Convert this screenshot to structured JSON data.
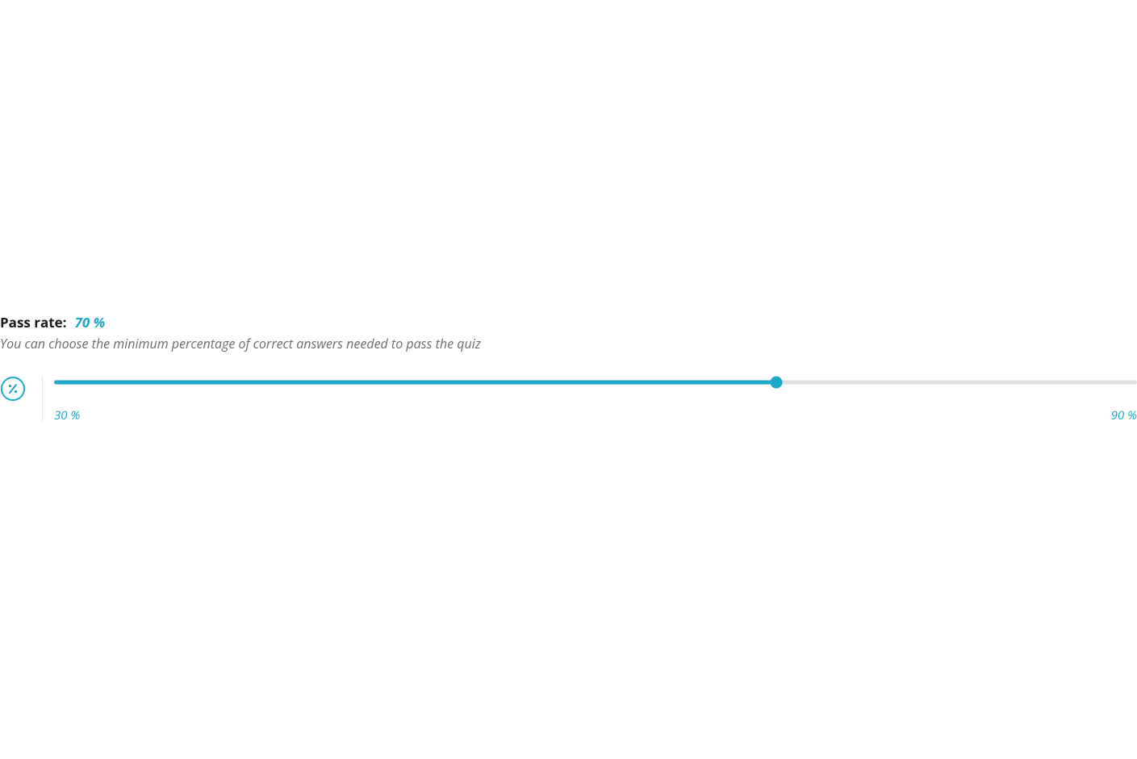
{
  "passRate": {
    "label": "Pass rate:",
    "value": "70 %",
    "description": "You can choose the minimum percentage of correct answers needed to pass the quiz",
    "slider": {
      "min": 30,
      "max": 90,
      "current": 70,
      "minLabel": "30 %",
      "maxLabel": "90 %"
    }
  },
  "colors": {
    "accent": "#1fa8c9"
  }
}
